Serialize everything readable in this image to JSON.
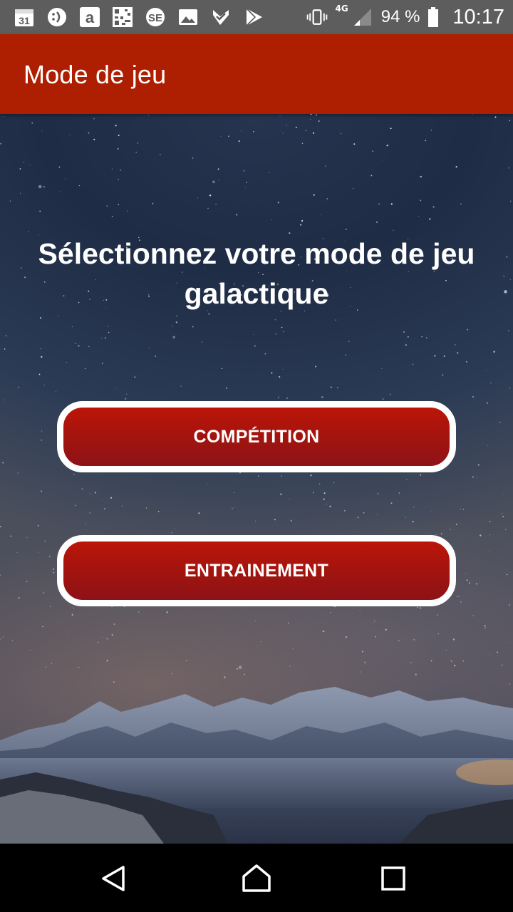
{
  "status_bar": {
    "notification_icons": [
      "calendar-icon",
      "chat-icon",
      "amazon-icon",
      "qr-code-icon",
      "se-icon",
      "image-icon",
      "check-icon",
      "play-store-icon"
    ],
    "calendar_day": "31",
    "network": "4G",
    "battery": "94 %",
    "time": "10:17"
  },
  "app_bar": {
    "title": "Mode de jeu",
    "color": "#ad1f00"
  },
  "main": {
    "heading": "Sélectionnez votre mode de jeu galactique",
    "buttons": {
      "competition": "COMPÉTITION",
      "training": "ENTRAINEMENT"
    },
    "button_color": "#a5140e"
  },
  "nav_bar": {
    "icons": [
      "back-icon",
      "home-icon",
      "recents-icon"
    ]
  }
}
